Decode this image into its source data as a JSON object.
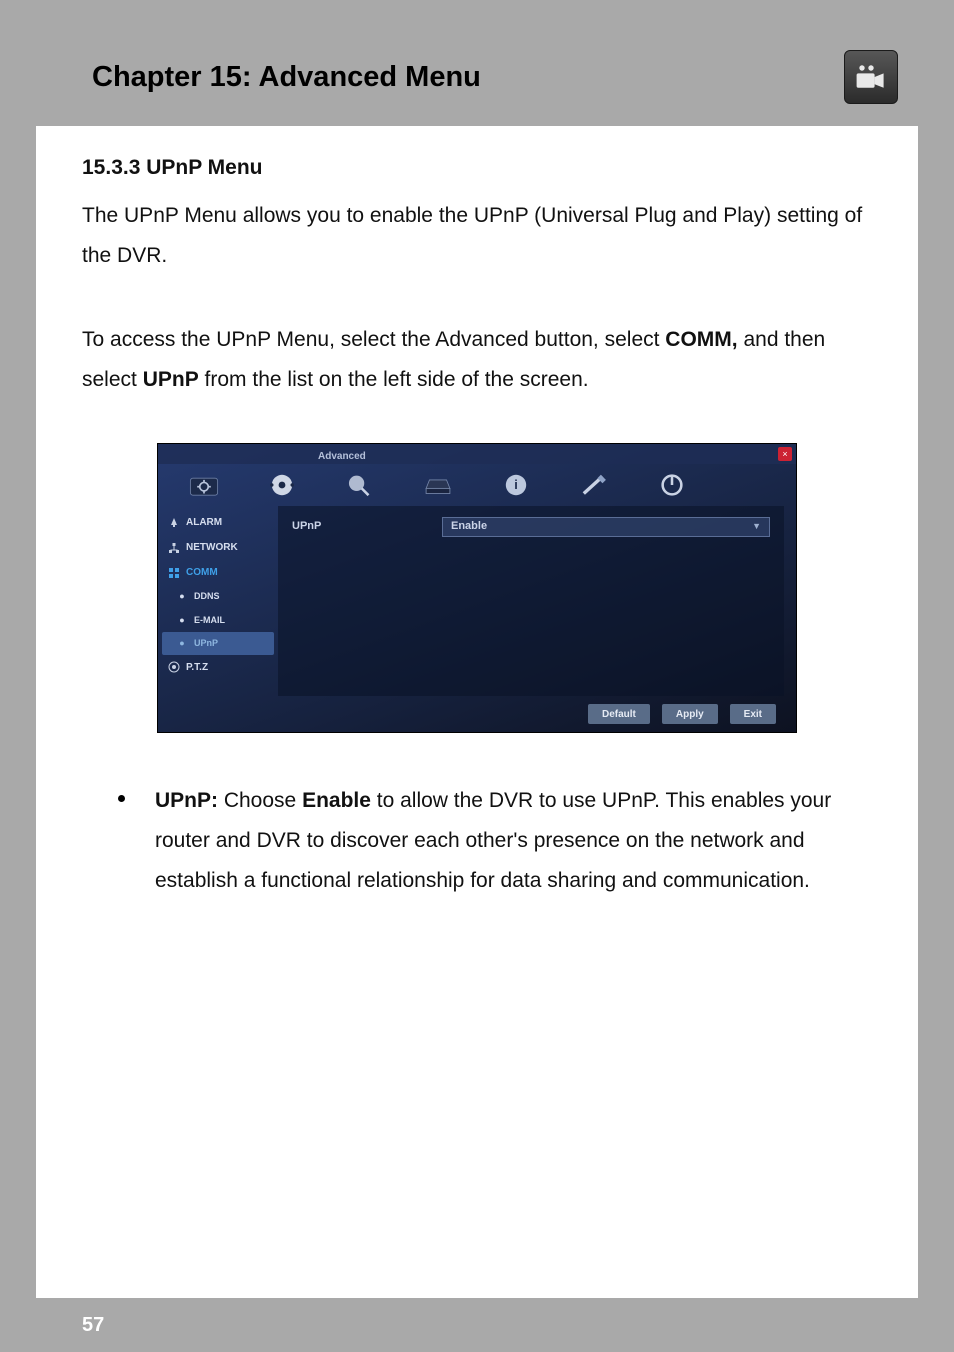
{
  "header": {
    "chapter_title": "Chapter 15: Advanced Menu",
    "corner_icon": "camera-device-icon"
  },
  "section": {
    "heading": "15.3.3 UPnP Menu",
    "para1": "The UPnP Menu allows you to enable the UPnP (Universal Plug and Play) setting of the DVR.",
    "para2_a": "To access the UPnP Menu, select the Advanced button, select ",
    "para2_b_strong": "COMM,",
    "para2_c": " and then select ",
    "para2_d_strong": "UPnP",
    "para2_e": " from the list on the left side of the screen."
  },
  "screenshot": {
    "window_title": "Advanced",
    "top_icons": [
      "settings-gear-icon",
      "dial-target-icon",
      "magnifier-icon",
      "hdd-icon",
      "info-icon",
      "brush-icon",
      "power-icon"
    ],
    "sidebar": {
      "items": [
        {
          "label": "ALARM",
          "icon": "bell-icon",
          "type": "main"
        },
        {
          "label": "NETWORK",
          "icon": "network-icon",
          "type": "main"
        },
        {
          "label": "COMM",
          "icon": "grid-icon",
          "type": "main_selected"
        },
        {
          "label": "DDNS",
          "icon": "bullet-icon",
          "type": "sub"
        },
        {
          "label": "E-MAIL",
          "icon": "bullet-icon",
          "type": "sub"
        },
        {
          "label": "UPnP",
          "icon": "bullet-icon",
          "type": "sub_selected"
        },
        {
          "label": "P.T.Z",
          "icon": "ptz-icon",
          "type": "main"
        }
      ]
    },
    "panel": {
      "field_label": "UPnP",
      "dropdown_value": "Enable"
    },
    "buttons": {
      "default": "Default",
      "apply": "Apply",
      "exit": "Exit"
    }
  },
  "bullet": {
    "lead_strong": "UPnP:",
    "text_a": " Choose ",
    "text_b_strong": "Enable",
    "text_c": " to allow the DVR to use UPnP. This enables your router and DVR to discover each other's presence on the network and establish a functional relationship for data sharing and communication."
  },
  "footer": {
    "page_number": "57"
  }
}
